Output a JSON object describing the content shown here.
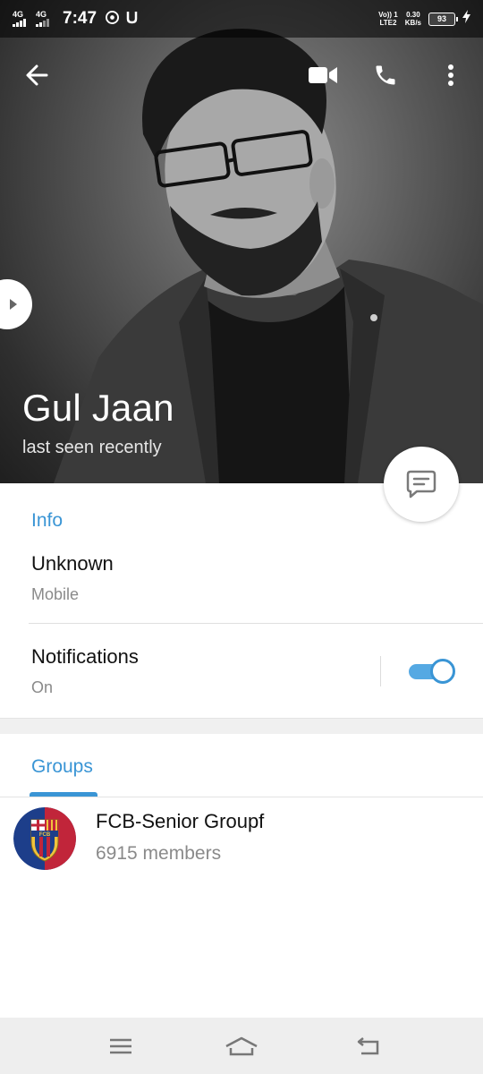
{
  "status_bar": {
    "network1": "4G",
    "network2": "4G",
    "time": "7:47",
    "icons": [
      "chrome-icon",
      "u-icon"
    ],
    "volte_line1": "Vo)) 1",
    "volte_line2": "LTE2",
    "speed_value": "0.30",
    "speed_unit": "KB/s",
    "battery": "93",
    "charging_icon": "bolt-icon"
  },
  "toolbar": {
    "back_icon": "arrow-left-icon",
    "video_icon": "video-camera-icon",
    "call_icon": "phone-icon",
    "menu_icon": "more-vertical-icon"
  },
  "profile": {
    "name": "Gul Jaan",
    "status": "last seen recently",
    "message_icon": "message-icon"
  },
  "info": {
    "title": "Info",
    "phone_value": "Unknown",
    "phone_label": "Mobile",
    "notifications_label": "Notifications",
    "notifications_value": "On",
    "notifications_enabled": true
  },
  "groups": {
    "tab_label": "Groups",
    "items": [
      {
        "name": "FCB-Senior Groupf",
        "members": "6915 members",
        "avatar_text": "FCB"
      }
    ]
  },
  "colors": {
    "accent": "#3a95d5",
    "toggle_track": "#55a9e3",
    "fcb_blue": "#1d3e8a",
    "fcb_red": "#c1253a"
  },
  "nav_bar": {
    "menu_icon": "menu-icon",
    "home_icon": "home-icon",
    "back_icon": "back-icon"
  }
}
